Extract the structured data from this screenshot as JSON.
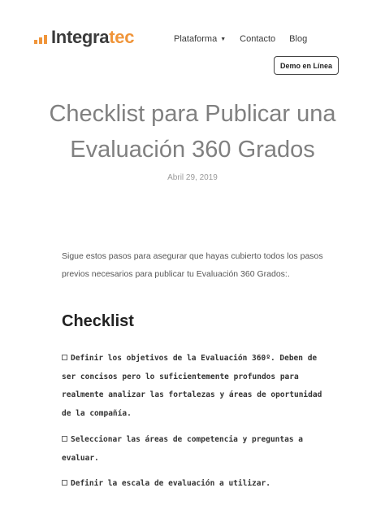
{
  "brand": {
    "name_part1": "Integra",
    "name_part2": "tec",
    "accent": "#f0953a"
  },
  "nav": {
    "plataforma": "Plataforma",
    "contacto": "Contacto",
    "blog": "Blog"
  },
  "header": {
    "demo_button": "Demo en Línea"
  },
  "article": {
    "title_lines": [
      "Checklist para Publicar una",
      "Evaluación 360 Grados"
    ],
    "date": "Abril 29, 2019",
    "intro_lines": [
      "Sigue estos pasos para asegurar que hayas cubierto todos los pasos",
      "previos necesarios para publicar tu Evaluación 360 Grados:."
    ],
    "checklist_heading": "Checklist",
    "items": [
      {
        "lines": [
          "Definir los objetivos de la Evaluación 360º. Deben de",
          "ser concisos pero lo suficientemente profundos para",
          "realmente analizar las fortalezas y áreas de oportunidad",
          "de la compañía."
        ]
      },
      {
        "lines": [
          "Seleccionar las áreas de competencia y preguntas a",
          "evaluar."
        ]
      },
      {
        "lines": [
          "Definir la escala de evaluación a utilizar."
        ]
      }
    ]
  }
}
